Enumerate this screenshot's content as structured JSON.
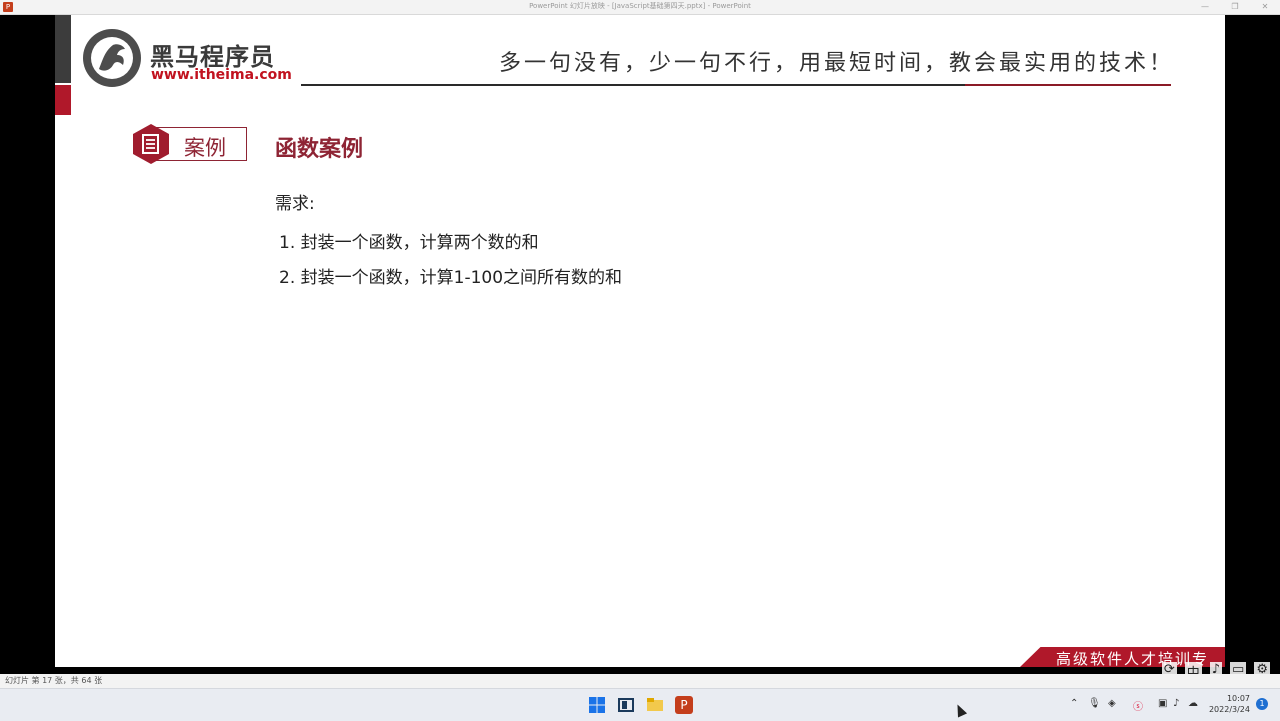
{
  "window": {
    "title": "PowerPoint 幻灯片放映 - [JavaScript基础第四天.pptx] - PowerPoint",
    "app_icon_letter": "P",
    "controls": [
      "—",
      "❐",
      "✕"
    ]
  },
  "slide": {
    "brand_name": "黑马程序员",
    "brand_url": "www.itheima.com",
    "slogan": "多一句没有，少一句不行，用最短时间，教会最实用的技术！",
    "case_label": "案例",
    "case_title": "函数案例",
    "requirement_label": "需求:",
    "requirements": [
      "1. 封装一个函数，计算两个数的和",
      "2. 封装一个函数，计算1-100之间所有数的和"
    ],
    "footer_tag": "高级软件人才培训专家"
  },
  "status_bar": {
    "slide_info": "幻灯片 第 17 张，共 64 张"
  },
  "overlay_tools": [
    "⟳",
    "中",
    "♪",
    "▭",
    "⚙"
  ],
  "taskbar": {
    "time": "10:07",
    "date": "2022/3/24",
    "notifications": "1"
  },
  "colors": {
    "brand_red": "#b0182a",
    "case_red": "#8e2434"
  }
}
